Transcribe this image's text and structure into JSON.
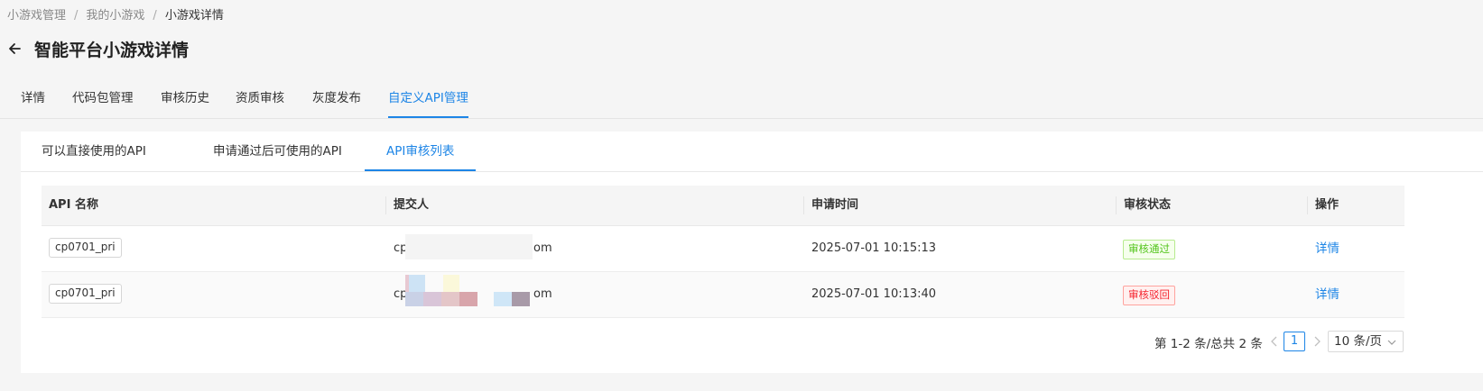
{
  "breadcrumb": [
    {
      "label": "小游戏管理"
    },
    {
      "label": "我的小游戏"
    },
    {
      "label": "小游戏详情"
    }
  ],
  "breadcrumb_separator": "/",
  "page_title": "智能平台小游戏详情",
  "tabs": [
    {
      "label": "详情"
    },
    {
      "label": "代码包管理"
    },
    {
      "label": "审核历史"
    },
    {
      "label": "资质审核"
    },
    {
      "label": "灰度发布"
    },
    {
      "label": "自定义API管理",
      "active": true
    }
  ],
  "subtabs": [
    {
      "label": "可以直接使用的API"
    },
    {
      "label": "申请通过后可使用的API"
    },
    {
      "label": "API审核列表",
      "active": true
    }
  ],
  "table": {
    "columns": [
      "API 名称",
      "提交人",
      "申请时间",
      "审核状态",
      "操作"
    ],
    "rows": [
      {
        "api_name": "cp0701_pri",
        "submitter_prefix": "cp",
        "submitter_suffix": "om",
        "time": "2025-07-01 10:15:13",
        "status": "审核通过",
        "status_type": "approved",
        "action": "详情"
      },
      {
        "api_name": "cp0701_pri",
        "submitter_prefix": "cp",
        "submitter_suffix": "om",
        "time": "2025-07-01 10:13:40",
        "status": "审核驳回",
        "status_type": "rejected",
        "action": "详情"
      }
    ]
  },
  "pagination": {
    "total_text": "第 1-2 条/总共 2 条",
    "current_page": "1",
    "page_size": "10 条/页"
  },
  "colors": {
    "accent": "#1d85e6",
    "approved": "#52c41a",
    "rejected": "#f5222d"
  }
}
